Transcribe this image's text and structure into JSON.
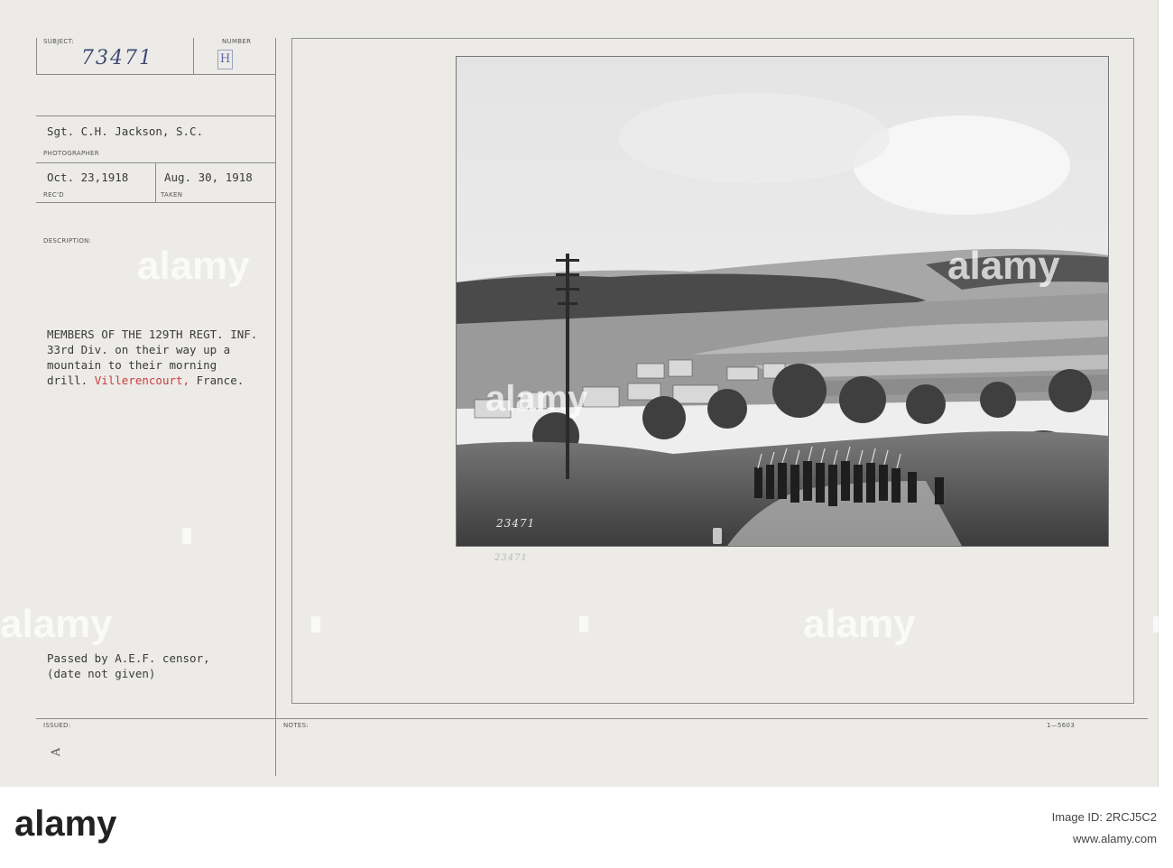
{
  "card": {
    "subject_label": "SUBJECT:",
    "number_label": "NUMBER",
    "subject_handwritten": "73471",
    "number_stamp": "H",
    "photographer": "Sgt. C.H. Jackson, S.C.",
    "photographer_label": "PHOTOGRAPHER",
    "received_date": "Oct. 23,1918",
    "received_label": "REC'D",
    "taken_date": "Aug. 30, 1918",
    "taken_label": "TAKEN",
    "description_label": "DESCRIPTION:",
    "description_line1": "MEMBERS OF THE 129TH REGT. INF.",
    "description_line2": "33rd Div. on their way up a",
    "description_line3": "mountain to their morning",
    "description_line4_a": "drill. ",
    "description_place_red": "Villerencourt,",
    "description_line4_b": " France.",
    "censor_line1": "Passed by A.E.F. censor,",
    "censor_line2": "(date not given)",
    "issued_label": "ISSUED:",
    "issued_mark": "A",
    "notes_label": "NOTES:",
    "form_code": "1—5603",
    "photo_number_handwritten": "23471",
    "under_photo_number": "23471"
  },
  "watermark": {
    "text": "alamy"
  },
  "footer": {
    "logo": "alamy",
    "image_id_label": "Image ID: 2RCJ5C2",
    "site": "www.alamy.com"
  },
  "colors": {
    "card": "#ecebe7",
    "red_text": "#cf3b3b",
    "ink": "#3a3a3a"
  }
}
